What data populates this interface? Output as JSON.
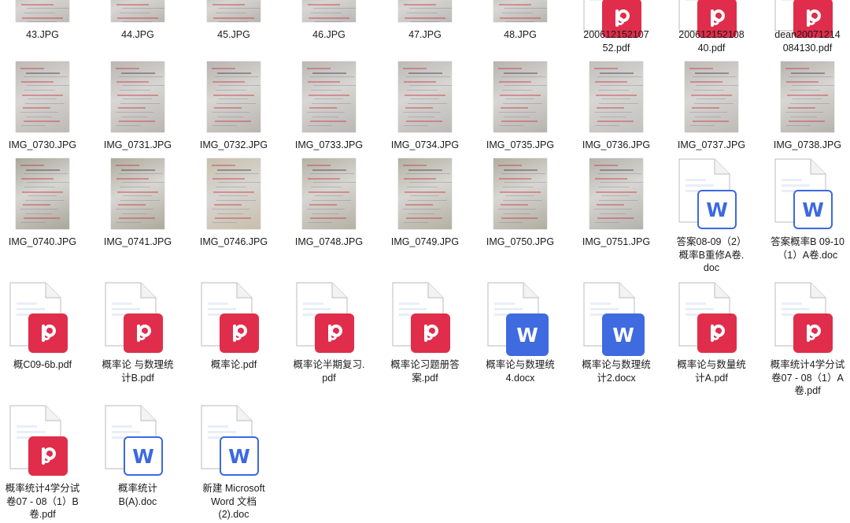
{
  "files": [
    {
      "name": "43.JPG",
      "kind": "jpg"
    },
    {
      "name": "44.JPG",
      "kind": "jpg"
    },
    {
      "name": "45.JPG",
      "kind": "jpg"
    },
    {
      "name": "46.JPG",
      "kind": "jpg"
    },
    {
      "name": "47.JPG",
      "kind": "jpg"
    },
    {
      "name": "48.JPG",
      "kind": "jpg"
    },
    {
      "name": "20061215210752.pdf",
      "kind": "pdf"
    },
    {
      "name": "20061215210840.pdf",
      "kind": "pdf"
    },
    {
      "name": "dean20071214084130.pdf",
      "kind": "pdf"
    },
    {
      "name": "IMG_0730.JPG",
      "kind": "jpg"
    },
    {
      "name": "IMG_0731.JPG",
      "kind": "jpg"
    },
    {
      "name": "IMG_0732.JPG",
      "kind": "jpg"
    },
    {
      "name": "IMG_0733.JPG",
      "kind": "jpg"
    },
    {
      "name": "IMG_0734.JPG",
      "kind": "jpg"
    },
    {
      "name": "IMG_0735.JPG",
      "kind": "jpg"
    },
    {
      "name": "IMG_0736.JPG",
      "kind": "jpg"
    },
    {
      "name": "IMG_0737.JPG",
      "kind": "jpg"
    },
    {
      "name": "IMG_0738.JPG",
      "kind": "jpg"
    },
    {
      "name": "IMG_0740.JPG",
      "kind": "jpg"
    },
    {
      "name": "IMG_0741.JPG",
      "kind": "jpg"
    },
    {
      "name": "IMG_0746.JPG",
      "kind": "jpg"
    },
    {
      "name": "IMG_0748.JPG",
      "kind": "jpg"
    },
    {
      "name": "IMG_0749.JPG",
      "kind": "jpg"
    },
    {
      "name": "IMG_0750.JPG",
      "kind": "jpg"
    },
    {
      "name": "IMG_0751.JPG",
      "kind": "jpg"
    },
    {
      "name": "答案08-09（2）概率B重修A卷.doc",
      "kind": "doc"
    },
    {
      "name": "答案概率B 09-10（1）A卷.doc",
      "kind": "doc"
    },
    {
      "name": "概C09-6b.pdf",
      "kind": "pdf"
    },
    {
      "name": "概率论 与数理统计B.pdf",
      "kind": "pdf"
    },
    {
      "name": "概率论.pdf",
      "kind": "pdf"
    },
    {
      "name": "概率论半期复习.pdf",
      "kind": "pdf"
    },
    {
      "name": "概率论习题册答案.pdf",
      "kind": "pdf"
    },
    {
      "name": "概率论与数理统4.docx",
      "kind": "docx"
    },
    {
      "name": "概率论与数理统计2.docx",
      "kind": "docx"
    },
    {
      "name": "概率论与数量统计A.pdf",
      "kind": "pdf"
    },
    {
      "name": "概率统计4学分试卷07 - 08（1）A卷.pdf",
      "kind": "pdf"
    },
    {
      "name": "概率统计4学分试卷07 - 08（1）B卷.pdf",
      "kind": "pdf"
    },
    {
      "name": "概率统计B(A).doc",
      "kind": "doc"
    },
    {
      "name": "新建 Microsoft Word 文档 (2).doc",
      "kind": "doc"
    }
  ],
  "labels": [
    [
      "43.JPG"
    ],
    [
      "44.JPG"
    ],
    [
      "45.JPG"
    ],
    [
      "46.JPG"
    ],
    [
      "47.JPG"
    ],
    [
      "48.JPG"
    ],
    [
      "200612152107",
      "52.pdf"
    ],
    [
      "200612152108",
      "40.pdf"
    ],
    [
      "dean20071214",
      "084130.pdf"
    ],
    [
      "IMG_0730.JPG"
    ],
    [
      "IMG_0731.JPG"
    ],
    [
      "IMG_0732.JPG"
    ],
    [
      "IMG_0733.JPG"
    ],
    [
      "IMG_0734.JPG"
    ],
    [
      "IMG_0735.JPG"
    ],
    [
      "IMG_0736.JPG"
    ],
    [
      "IMG_0737.JPG"
    ],
    [
      "IMG_0738.JPG"
    ],
    [
      "IMG_0740.JPG"
    ],
    [
      "IMG_0741.JPG"
    ],
    [
      "IMG_0746.JPG"
    ],
    [
      "IMG_0748.JPG"
    ],
    [
      "IMG_0749.JPG"
    ],
    [
      "IMG_0750.JPG"
    ],
    [
      "IMG_0751.JPG"
    ],
    [
      "答案08-09（2）",
      "概率B重修A卷.",
      "doc"
    ],
    [
      "答案概率B 09-10",
      "（1）A卷.doc"
    ],
    [
      "概C09-6b.pdf"
    ],
    [
      "概率论 与数理统",
      "计B.pdf"
    ],
    [
      "概率论.pdf"
    ],
    [
      "概率论半期复习.",
      "pdf"
    ],
    [
      "概率论习题册答",
      "案.pdf"
    ],
    [
      "概率论与数理统",
      "4.docx"
    ],
    [
      "概率论与数理统",
      "计2.docx"
    ],
    [
      "概率论与数量统",
      "计A.pdf"
    ],
    [
      "概率统计4学分试",
      "卷07 - 08（1）A",
      "卷.pdf"
    ],
    [
      "概率统计4学分试",
      "卷07 - 08（1）B",
      "卷.pdf"
    ],
    [
      "概率统计",
      "B(A).doc"
    ],
    [
      "新建 Microsoft",
      "Word 文档",
      "(2).doc"
    ]
  ],
  "colors": {
    "pdf_badge": "#e02d4b",
    "word_badge": "#3f6ae0",
    "word_badge_light_border": "#3d69df"
  },
  "icons": {
    "jpg": "photo-thumbnail",
    "pdf": "pdf-file-icon",
    "doc": "word-doc-icon",
    "docx": "word-docx-icon"
  }
}
